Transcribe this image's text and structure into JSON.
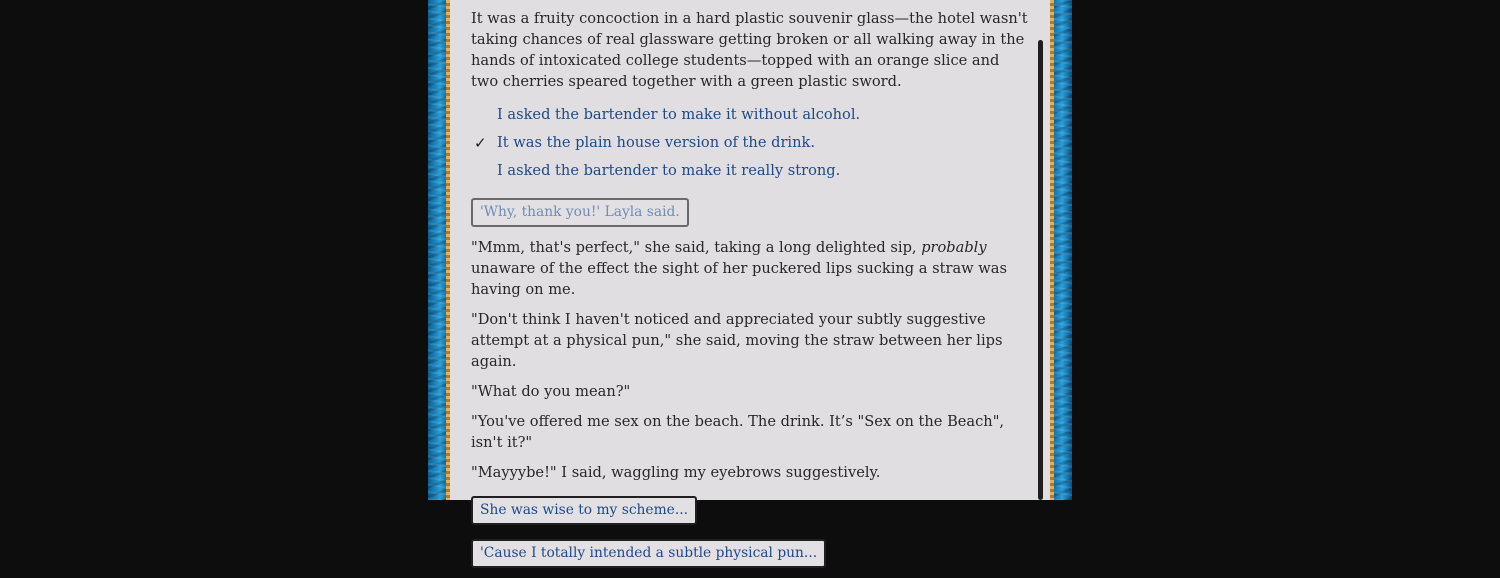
{
  "paragraphs_top": [
    "It was a fruity concoction in a hard plastic souvenir glass—the hotel wasn't taking chances of real glassware getting broken or all walking away in the hands of intoxicated college students—topped with an orange slice and two cherries speared together with a green plastic sword."
  ],
  "choices": [
    {
      "label": "I asked the bartender to make it without alcohol.",
      "check": ""
    },
    {
      "label": "It was the plain house version of the drink.",
      "check": "✓"
    },
    {
      "label": "I asked the bartender to make it really strong.",
      "check": ""
    }
  ],
  "used_button": "'Why, thank you!' Layla said.",
  "p_mmm": {
    "before": "\"Mmm, that's perfect,\" she said, taking a long delighted sip, ",
    "italic": "probably",
    "after": " unaware of the effect the sight of her puckered lips sucking a straw was having on me."
  },
  "paragraphs_bottom": [
    "\"Don't think I haven't noticed and appreciated your subtly suggestive attempt at a physical pun,\" she said, moving the straw between her lips again.",
    "\"What do you mean?\"",
    "\"You've offered me sex on the beach. The drink. It’s \"Sex on the Beach\", isn't it?\"",
    "\"Mayyybe!\" I said, waggling my eyebrows suggestively."
  ],
  "option_buttons": [
    "She was wise to my scheme...",
    "'Cause I totally intended a subtle physical pun..."
  ]
}
